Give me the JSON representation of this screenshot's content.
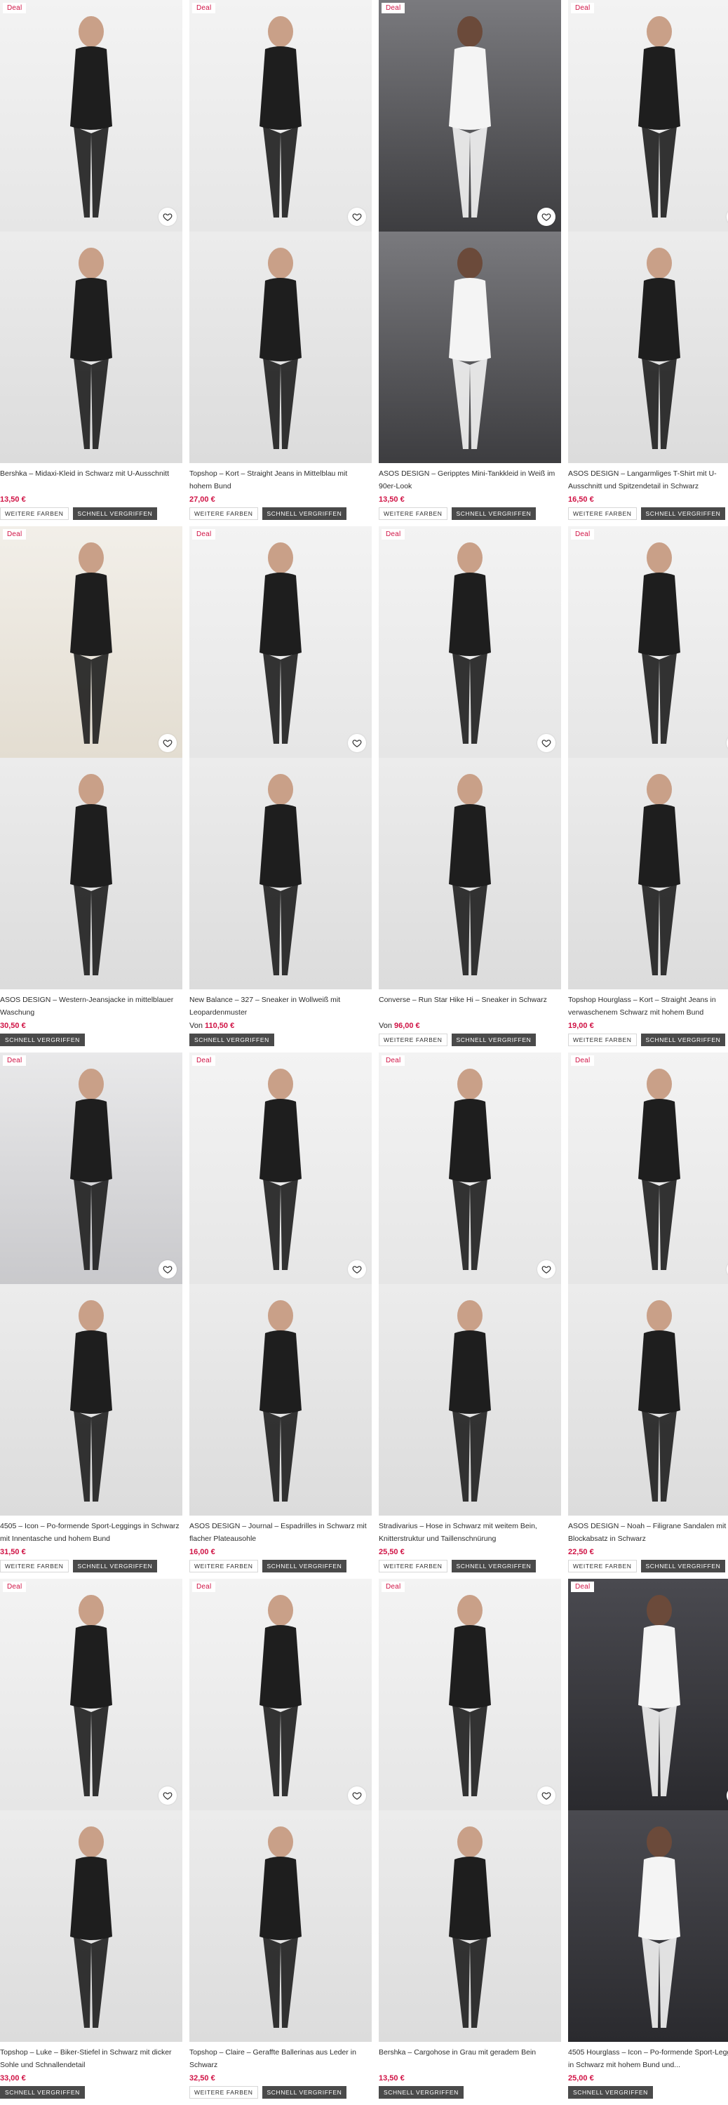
{
  "colors": {
    "deal": "#d01345",
    "price": "#d01345",
    "fast_badge_bg": "#4a4a4a"
  },
  "deal_label": "Deal",
  "badge_labels": {
    "more_colors": "WEITERE FARBEN",
    "fast_sold": "SCHNELL VERGRIFFEN"
  },
  "products": [
    {
      "name": "Bershka – Midaxi-Kleid in Schwarz mit U-Ausschnitt",
      "price": "13,50 €",
      "price_prefix": "",
      "deal": true,
      "badges": [
        "more_colors",
        "fast_sold"
      ],
      "tone": "top"
    },
    {
      "name": "Topshop – Kort – Straight Jeans in Mittelblau mit hohem Bund",
      "price": "27,00 €",
      "price_prefix": "",
      "deal": true,
      "badges": [
        "more_colors",
        "fast_sold"
      ],
      "tone": "top"
    },
    {
      "name": "ASOS DESIGN – Geripptes Mini-Tankkleid in Weiß im 90er-Look",
      "price": "13,50 €",
      "price_prefix": "",
      "deal": true,
      "badges": [
        "more_colors",
        "fast_sold"
      ],
      "tone": "dark"
    },
    {
      "name": "ASOS DESIGN – Langarmliges T-Shirt mit U-Ausschnitt und Spitzendetail in Schwarz",
      "price": "16,50 €",
      "price_prefix": "",
      "deal": true,
      "badges": [
        "more_colors",
        "fast_sold"
      ],
      "tone": "top"
    },
    {
      "name": "ASOS DESIGN – Western-Jeansjacke in mittelblauer Waschung",
      "price": "30,50 €",
      "price_prefix": "",
      "deal": true,
      "badges": [
        "fast_sold"
      ],
      "tone": "warm"
    },
    {
      "name": "New Balance – 327 – Sneaker in Wollweiß mit Leopardenmuster",
      "price": "110,50 €",
      "price_prefix": "Von",
      "deal": true,
      "badges": [
        "fast_sold"
      ],
      "tone": "top"
    },
    {
      "name": "Converse – Run Star Hike Hi – Sneaker in Schwarz",
      "price": "96,00 €",
      "price_prefix": "Von",
      "deal": true,
      "badges": [
        "more_colors",
        "fast_sold"
      ],
      "tone": "top"
    },
    {
      "name": "Topshop Hourglass – Kort – Straight Jeans in verwaschenem Schwarz mit hohem Bund",
      "price": "19,00 €",
      "price_prefix": "",
      "deal": true,
      "badges": [
        "more_colors",
        "fast_sold"
      ],
      "tone": "top"
    },
    {
      "name": "4505 – Icon – Po-formende Sport-Leggings in Schwarz mit Innentasche und hohem Bund",
      "price": "31,50 €",
      "price_prefix": "",
      "deal": true,
      "badges": [
        "more_colors",
        "fast_sold"
      ],
      "tone": "mid"
    },
    {
      "name": "ASOS DESIGN – Journal – Espadrilles in Schwarz mit flacher Plateausohle",
      "price": "16,00 €",
      "price_prefix": "",
      "deal": true,
      "badges": [
        "more_colors",
        "fast_sold"
      ],
      "tone": "top"
    },
    {
      "name": "Stradivarius – Hose in Schwarz mit weitem Bein, Knitterstruktur und Taillenschnürung",
      "price": "25,50 €",
      "price_prefix": "",
      "deal": true,
      "badges": [
        "more_colors",
        "fast_sold"
      ],
      "tone": "top"
    },
    {
      "name": "ASOS DESIGN – Noah – Filigrane Sandalen mit Blockabsatz in Schwarz",
      "price": "22,50 €",
      "price_prefix": "",
      "deal": true,
      "badges": [
        "more_colors",
        "fast_sold"
      ],
      "tone": "top"
    },
    {
      "name": "Topshop – Luke – Biker-Stiefel in Schwarz mit dicker Sohle und Schnallendetail",
      "price": "33,00 €",
      "price_prefix": "",
      "deal": true,
      "badges": [
        "fast_sold"
      ],
      "tone": "top"
    },
    {
      "name": "Topshop – Claire – Geraffte Ballerinas aus Leder in Schwarz",
      "price": "32,50 €",
      "price_prefix": "",
      "deal": true,
      "badges": [
        "more_colors",
        "fast_sold"
      ],
      "tone": "top"
    },
    {
      "name": "Bershka – Cargohose in Grau mit geradem Bein",
      "price": "13,50 €",
      "price_prefix": "",
      "deal": true,
      "badges": [
        "fast_sold"
      ],
      "tone": "top"
    },
    {
      "name": "4505 Hourglass – Icon – Po-formende Sport-Leggings in Schwarz mit hohem Bund und...",
      "price": "25,00 €",
      "price_prefix": "",
      "deal": true,
      "badges": [
        "fast_sold"
      ],
      "tone": "dark2"
    }
  ]
}
